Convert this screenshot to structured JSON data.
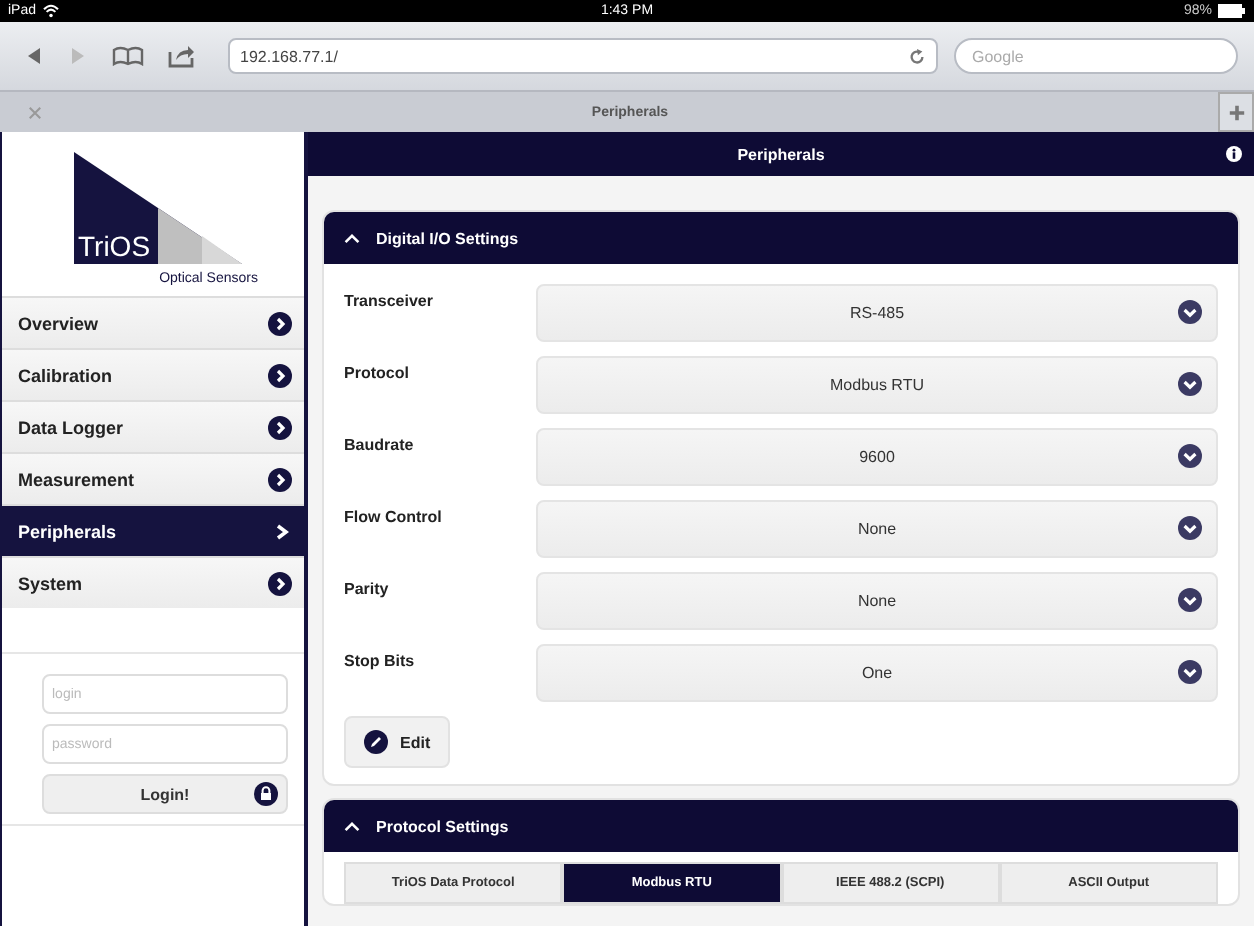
{
  "status_bar": {
    "carrier": "iPad",
    "time": "1:43 PM",
    "battery": "98%"
  },
  "browser": {
    "url": "192.168.77.1/",
    "search_placeholder": "Google",
    "tab_title": "Peripherals"
  },
  "sidebar": {
    "logo": {
      "name": "TriOS",
      "tagline": "Optical Sensors"
    },
    "items": [
      {
        "label": "Overview",
        "selected": false
      },
      {
        "label": "Calibration",
        "selected": false
      },
      {
        "label": "Data Logger",
        "selected": false
      },
      {
        "label": "Measurement",
        "selected": false
      },
      {
        "label": "Peripherals",
        "selected": true
      },
      {
        "label": "System",
        "selected": false
      }
    ],
    "login": {
      "login_placeholder": "login",
      "password_placeholder": "password",
      "button": "Login!"
    }
  },
  "main": {
    "title": "Peripherals",
    "sections": [
      {
        "title": "Digital I/O Settings",
        "expanded": true,
        "fields": [
          {
            "label": "Transceiver",
            "value": "RS-485"
          },
          {
            "label": "Protocol",
            "value": "Modbus RTU"
          },
          {
            "label": "Baudrate",
            "value": "9600"
          },
          {
            "label": "Flow Control",
            "value": "None"
          },
          {
            "label": "Parity",
            "value": "None"
          },
          {
            "label": "Stop Bits",
            "value": "One"
          }
        ],
        "edit_button": "Edit"
      },
      {
        "title": "Protocol Settings",
        "expanded": true,
        "tabs": [
          {
            "label": "TriOS Data Protocol",
            "selected": false
          },
          {
            "label": "Modbus RTU",
            "selected": true
          },
          {
            "label": "IEEE 488.2 (SCPI)",
            "selected": false
          },
          {
            "label": "ASCII Output",
            "selected": false
          }
        ]
      }
    ]
  }
}
